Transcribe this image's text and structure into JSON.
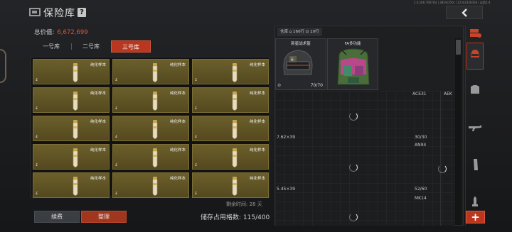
{
  "header": {
    "title": "保险库",
    "help_label": "?",
    "sysinfo": "1.0.166.7667(6) | 3854(350) | 12343328358 | 远航1-4"
  },
  "vault": {
    "total_label": "总价值:",
    "total_value": "6,672,699",
    "tabs": [
      {
        "label": "一号库",
        "active": false
      },
      {
        "label": "二号库",
        "active": false
      },
      {
        "label": "三号库",
        "active": true
      }
    ],
    "cell_label": "纯化样本",
    "cell_mark": "£",
    "remain_label": "剩余时间: 28 天",
    "renew_label": "续费",
    "sort_label": "整理",
    "storage_label": "储存占用格数: 115/400"
  },
  "warehouse": {
    "tag_label": "仓库",
    "tag_rows": "160行",
    "tag_other": "10行",
    "items": [
      {
        "name": "新星战术盔",
        "count": "70/70",
        "icon": "helmet-icon"
      },
      {
        "name": "FA多功能",
        "count": "",
        "icon": "backpack-icon"
      }
    ],
    "slots": [
      {
        "name": "ACE31",
        "caliber": "7.62×39",
        "count": "30/30"
      },
      {
        "name": "AEK",
        "caliber": "",
        "count": ""
      },
      {
        "name": "AN94",
        "caliber": "5.45×39",
        "count": "52/60"
      },
      {
        "name": "MK14",
        "caliber": "",
        "count": ""
      }
    ]
  },
  "sidebar": {
    "categories": [
      "all-items-icon",
      "helmet-category-icon",
      "vest-category-icon",
      "rifle-category-icon",
      "magazine-category-icon",
      "ammo-category-icon"
    ],
    "add_label": "+"
  },
  "colors": {
    "accent": "#b8371e",
    "cell_bg": "#5e5226",
    "total_value": "#e2522f"
  }
}
